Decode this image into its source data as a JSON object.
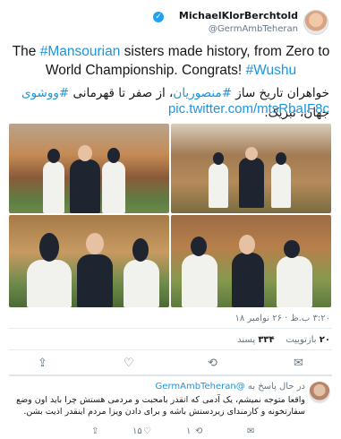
{
  "header": {
    "display_name": "MichaelKlorBerchtold",
    "handle": "@GermAmbTeheran",
    "verified_icon": "verified-badge-icon"
  },
  "tweet": {
    "en_prefix": "The ",
    "en_hashtag1": "#Mansourian",
    "en_middle": " sisters made history, from Zero to World Championship. Congrats! ",
    "en_hashtag2": "#Wushu",
    "fa_part1": "خواهران تاریخ ساز ",
    "fa_hashtag1": "#منصوریان",
    "fa_part2": "، از صفر تا قهرمانی ",
    "fa_hashtag2": "#ووشوی",
    "fa_part3": " جهان، تبریک.",
    "link": "pic.twitter.com/mtsRbaIF8c"
  },
  "meta": {
    "time": "۳:۲۰ ب.ظ · ۲۶ نوامبر ۱۸"
  },
  "stats": {
    "retweets_count": "۲۰",
    "retweets_label": "بازتوییت",
    "likes_count": "۳۳۴",
    "likes_label": "پسند"
  },
  "actions": {
    "share_icon": "share-icon",
    "like_icon": "heart-icon",
    "retweet_icon": "retweet-icon",
    "reply_icon": "reply-icon"
  },
  "reply": {
    "in_reply_prefix": "در حال پاسخ به",
    "in_reply_handle": "@GermAmbTeheran",
    "text": "واقعا متوجه نمیشم، یک آدمی که انقدر بامحبت و مردمی هستش چرا باید اون وضع سفارتخونه و کارمندای زیردستش باشه و برای دادن ویزا مردم اینقدر اذیت بشن.",
    "like_count": "۱۵",
    "retweet_count": "۱"
  }
}
